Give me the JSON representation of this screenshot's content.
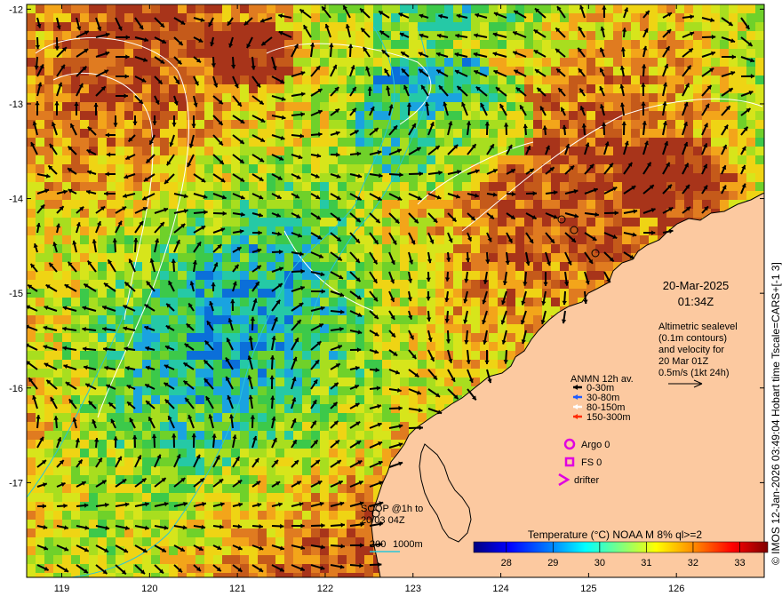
{
  "map": {
    "lon_ticks": [
      "119",
      "120",
      "121",
      "122",
      "123",
      "124",
      "125",
      "126"
    ],
    "lat_ticks": [
      "-12",
      "-13",
      "-14",
      "-15",
      "-16",
      "-17"
    ],
    "lon_range": [
      118.6,
      127.0
    ],
    "lat_range": [
      -18.0,
      -11.95
    ],
    "land_color": "#fcc9a0",
    "credit": "© IMOS 12-Jan-2026 03:49:04 Hobart time Tscale=CARS+[-1 3]"
  },
  "timestamp": {
    "date": "20-Mar-2025",
    "time": "01:34Z"
  },
  "altimetry_note": {
    "lines": [
      "Altimetric sealevel",
      "(0.1m contours)",
      "and velocity for",
      "20 Mar 01Z",
      "0.5m/s (1kt 24h)"
    ]
  },
  "anmn_legend": {
    "title": "ANMN 12h av.",
    "items": [
      {
        "label": "0-30m",
        "color": "#000000"
      },
      {
        "label": "30-80m",
        "color": "#1e5bff"
      },
      {
        "label": "80-150m",
        "color": "#ffffff"
      },
      {
        "label": "150-300m",
        "color": "#ff2a00"
      }
    ]
  },
  "platform_legend": {
    "argo": "Argo 0",
    "fs": "FS 0",
    "drifter": "drifter",
    "color": "#e000e0"
  },
  "soop": {
    "line1": "SOOP @1h to",
    "line2": "20/03 04Z"
  },
  "isobaths": {
    "label1": "200",
    "label2": "1000m",
    "color": "#29c5d8"
  },
  "colorbar": {
    "title": "Temperature (°C) NOAA   M 8% ql>=2",
    "ticks": [
      "28",
      "29",
      "30",
      "31",
      "32",
      "33"
    ],
    "range": [
      27.3,
      33.6
    ],
    "colors": [
      "#00007f",
      "#0000ff",
      "#007fff",
      "#00ffff",
      "#7fff7f",
      "#ffff00",
      "#ff7f00",
      "#ff0000",
      "#7f0000"
    ]
  }
}
